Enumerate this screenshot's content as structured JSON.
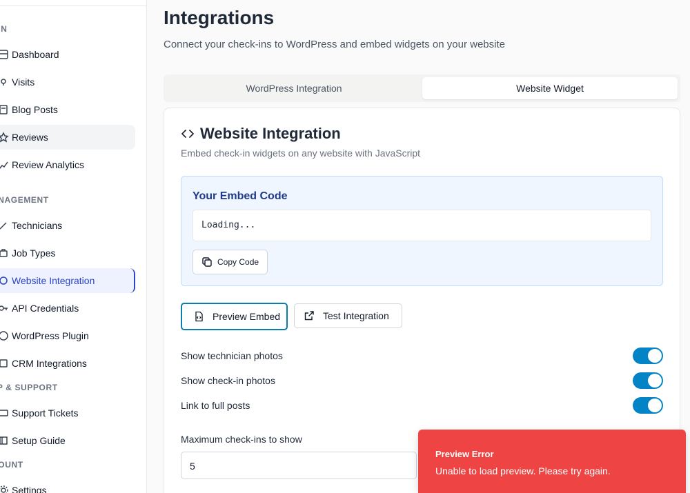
{
  "sidebar": {
    "sections": [
      {
        "label": "AIN"
      },
      {
        "label": "ANAGEMENT"
      },
      {
        "label": "LP & SUPPORT"
      },
      {
        "label": "COUNT"
      }
    ],
    "items": [
      {
        "label": "Dashboard",
        "icon": "dashboard-icon"
      },
      {
        "label": "Visits",
        "icon": "visits-icon"
      },
      {
        "label": "Blog Posts",
        "icon": "blog-posts-icon"
      },
      {
        "label": "Reviews",
        "icon": "star-icon"
      },
      {
        "label": "Review Analytics",
        "icon": "analytics-icon"
      },
      {
        "label": "Technicians",
        "icon": "technicians-icon"
      },
      {
        "label": "Job Types",
        "icon": "job-types-icon"
      },
      {
        "label": "Website Integration",
        "icon": "integration-icon"
      },
      {
        "label": "API Credentials",
        "icon": "key-icon"
      },
      {
        "label": "WordPress Plugin",
        "icon": "wordpress-icon"
      },
      {
        "label": "CRM Integrations",
        "icon": "crm-icon"
      },
      {
        "label": "Support Tickets",
        "icon": "ticket-icon"
      },
      {
        "label": "Setup Guide",
        "icon": "guide-icon"
      },
      {
        "label": "Settings",
        "icon": "gear-icon"
      }
    ]
  },
  "page": {
    "title": "Integrations",
    "subtitle": "Connect your check-ins to WordPress and embed widgets on your website"
  },
  "tabs": [
    {
      "label": "WordPress Integration",
      "selected": false
    },
    {
      "label": "Website Widget",
      "selected": true
    }
  ],
  "card": {
    "title": "Website Integration",
    "subtitle": "Embed check-in widgets on any website with JavaScript",
    "embed": {
      "title": "Your Embed Code",
      "code": "Loading...",
      "copy_label": "Copy Code"
    },
    "preview_label": "Preview Embed",
    "test_label": "Test Integration",
    "toggles": [
      {
        "label": "Show technician photos",
        "on": true
      },
      {
        "label": "Show check-in photos",
        "on": true
      },
      {
        "label": "Link to full posts",
        "on": true
      }
    ],
    "max_label": "Maximum check-ins to show",
    "max_value": "5"
  },
  "toast": {
    "title": "Preview Error",
    "message": "Unable to load preview. Please try again."
  },
  "colors": {
    "accent": "#2b44c8",
    "toggle": "#0284c7",
    "error": "#ef4444"
  }
}
